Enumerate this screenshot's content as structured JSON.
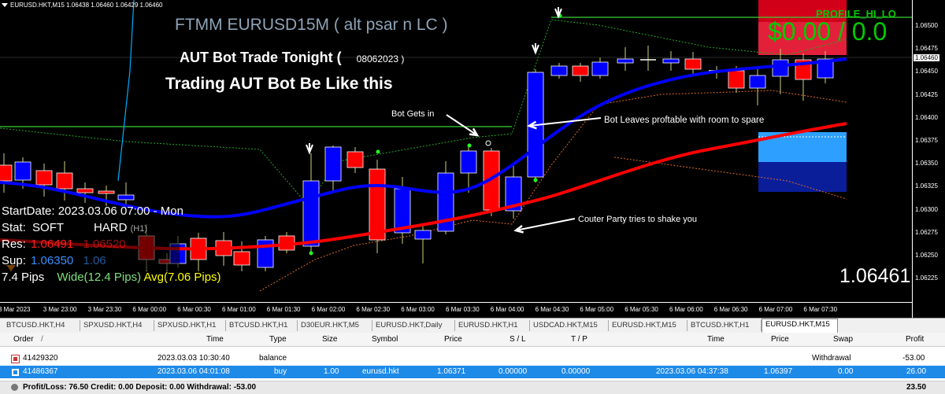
{
  "chart": {
    "symbol_info": "EURUSD.HKT,M15  1.06438 1.06460 1.06429 1.06460",
    "title": "FTMM EURUSD15M ( alt psar n LC )",
    "profile_label": "PROFILE_HI_LO",
    "profit_display": "$0.00 / 0.0",
    "headline1": "AUT Bot Trade Tonight  (",
    "headline_date": "08062023 )",
    "headline2": "Trading AUT Bot Be Like this",
    "ann_gets_in": "Bot Gets in",
    "ann_leaves": "Bot Leaves proftable with room to spare",
    "ann_counter": "Couter Party  tries to shake you",
    "start_date": "StartDate: 2023.03.06 07:00 - Mon",
    "stat_label": "Stat:",
    "stat_soft": "SOFT",
    "stat_hard": "HARD",
    "stat_h1": "(H1)",
    "res_label": "Res:",
    "res_value": "1.06491",
    "res_hard": "1.06520",
    "sup_label": "Sup:",
    "sup_value": "1.06350",
    "sup_hard": "1.06",
    "pips": "7.4 Pips",
    "wide": "Wide(12.4 Pips)",
    "avg": "Avg(7.06 Pips)",
    "big_price": "1.06461",
    "current_price_tag": "1.06460",
    "price_ticks": [
      "1.06500",
      "1.06475",
      "1.06450",
      "1.06425",
      "1.06400",
      "1.06375",
      "1.06350",
      "1.06325",
      "1.06300",
      "1.06275",
      "1.06250",
      "1.06225"
    ],
    "time_ticks": [
      "3 Mar 2023",
      "3 Mar 23:00",
      "3 Mar 23:30",
      "6 Mar 00:00",
      "6 Mar 00:30",
      "6 Mar 01:00",
      "6 Mar 01:30",
      "6 Mar 02:00",
      "6 Mar 02:30",
      "6 Mar 03:00",
      "6 Mar 03:30",
      "6 Mar 04:00",
      "6 Mar 04:30",
      "6 Mar 05:00",
      "6 Mar 05:30",
      "6 Mar 06:00",
      "6 Mar 06:30",
      "6 Mar 07:00",
      "6 Mar 07:30"
    ],
    "colors": {
      "bull": "#0000ff",
      "bear": "#ff0000",
      "ma_fast": "#0000ff",
      "ma_slow": "#ff0000",
      "psar": "#00ff00",
      "res_zone": "#e0102a",
      "sup_zone": "#1e90ff",
      "profit": "#00cc00"
    }
  },
  "tabs": [
    {
      "label": "BTCUSD.HKT,H4"
    },
    {
      "label": "SPXUSD.HKT,H4"
    },
    {
      "label": "SPXUSD.HKT,H1"
    },
    {
      "label": "BTCUSD.HKT,H1"
    },
    {
      "label": "D30EUR.HKT,M5"
    },
    {
      "label": "EURUSD.HKT,Daily"
    },
    {
      "label": "EURUSD.HKT,H1"
    },
    {
      "label": "USDCAD.HKT,M15"
    },
    {
      "label": "EURUSD.HKT,M15"
    },
    {
      "label": "BTCUSD.HKT,H1"
    },
    {
      "label": "EURUSD.HKT,M15",
      "active": true
    }
  ],
  "terminal": {
    "columns": {
      "order": "Order",
      "sort": "/",
      "time": "Time",
      "type": "Type",
      "size": "Size",
      "symbol": "Symbol",
      "price": "Price",
      "sl": "S / L",
      "tp": "T / P",
      "time2": "Time",
      "price2": "Price",
      "swap": "Swap",
      "profit": "Profit"
    },
    "rows": [
      {
        "order": "41429320",
        "time": "2023.03.03 10:30:40",
        "type": "balance",
        "size": "",
        "symbol": "",
        "price": "",
        "sl": "",
        "tp": "",
        "time2": "",
        "price2": "",
        "swap": "Withdrawal",
        "profit": "-53.00"
      },
      {
        "order": "41486367",
        "time": "2023.03.06 04:01:08",
        "type": "buy",
        "size": "1.00",
        "symbol": "eurusd.hkt",
        "price": "1.06371",
        "sl": "0.00000",
        "tp": "0.00000",
        "time2": "2023.03.06 04:37:38",
        "price2": "1.06397",
        "swap": "0.00",
        "profit": "26.00"
      }
    ],
    "summary": "Profit/Loss: 76.50  Credit: 0.00  Deposit: 0.00  Withdrawal: -53.00",
    "summary_total": "23.50"
  }
}
